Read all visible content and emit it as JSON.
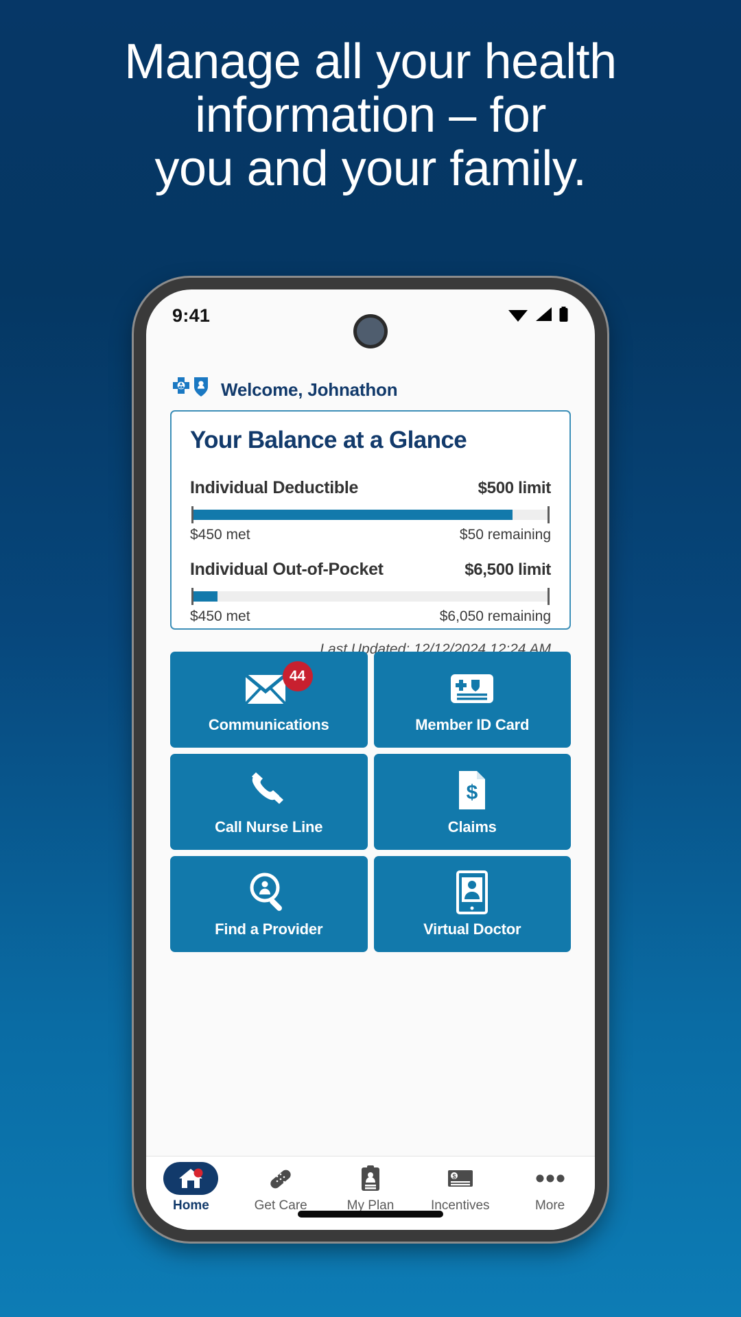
{
  "headline": {
    "lines": [
      "Manage all your health",
      "information – for",
      "you and your family."
    ]
  },
  "colors": {
    "background_top": "#063767",
    "background_bottom": "#0d7cb5",
    "brand_navy": "#123a6b",
    "tile_blue": "#1279ab",
    "badge_red": "#c8202f",
    "card_border": "#3d8fb8"
  },
  "phone": {
    "status_bar": {
      "time": "9:41",
      "icons": [
        "wifi-icon",
        "cellular-signal-icon",
        "battery-icon"
      ]
    },
    "header": {
      "logo": "blue-cross-blue-shield-logo",
      "welcome": "Welcome, Johnathon"
    },
    "balance_card": {
      "title": "Your Balance at a Glance",
      "metrics": [
        {
          "name": "Individual Deductible",
          "limit": "$500 limit",
          "met": "$450 met",
          "remaining": "$50 remaining",
          "percent": 90
        },
        {
          "name": "Individual Out-of-Pocket",
          "limit": "$6,500 limit",
          "met": "$450 met",
          "remaining": "$6,050 remaining",
          "percent": 7
        }
      ],
      "last_updated": "Last Updated: 12/12/2024 12:24 AM"
    },
    "tiles": [
      {
        "label": "Communications",
        "icon": "envelope-icon",
        "badge": "44"
      },
      {
        "label": "Member ID Card",
        "icon": "id-card-icon",
        "badge": ""
      },
      {
        "label": "Call Nurse Line",
        "icon": "phone-handset-icon",
        "badge": ""
      },
      {
        "label": "Claims",
        "icon": "document-dollar-icon",
        "badge": ""
      },
      {
        "label": "Find a Provider",
        "icon": "magnifier-person-icon",
        "badge": ""
      },
      {
        "label": "Virtual Doctor",
        "icon": "tablet-doctor-icon",
        "badge": ""
      }
    ],
    "nav": [
      {
        "label": "Home",
        "icon": "home-icon",
        "active": true
      },
      {
        "label": "Get Care",
        "icon": "bandage-icon",
        "active": false
      },
      {
        "label": "My Plan",
        "icon": "clipboard-icon",
        "active": false
      },
      {
        "label": "Incentives",
        "icon": "money-card-icon",
        "active": false
      },
      {
        "label": "More",
        "icon": "ellipsis-icon",
        "active": false
      }
    ]
  }
}
